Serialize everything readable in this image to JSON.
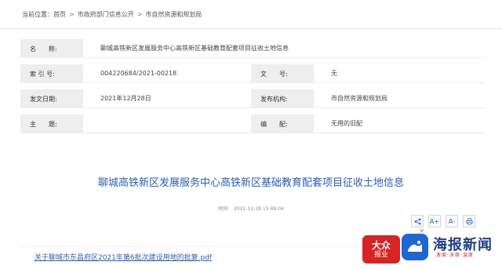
{
  "breadcrumb": {
    "label": "当前位置：",
    "items": [
      "首页",
      "市政府部门信息公开",
      "市自然资源和规划局"
    ],
    "separator": ">"
  },
  "info": {
    "name": {
      "label": "名　　称:",
      "value": "聊城高铁新区发展服务中心高铁新区基础教育配套项目征收土地信息"
    },
    "index": {
      "label": "索 引 号:",
      "value": "004220684/2021-00218"
    },
    "doc_no": {
      "label": "文　　号:",
      "value": "无"
    },
    "date": {
      "label": "发文日期:",
      "value": "2021年12月28日"
    },
    "org": {
      "label": "发布机构:",
      "value": "市自然资源和规划局"
    },
    "subject": {
      "label": "主　　题:",
      "value": ""
    },
    "category": {
      "label": "编　　配:",
      "value": "无用的旧配"
    }
  },
  "article": {
    "title": "聊城高铁新区发展服务中心高铁新区基础教育配套项目征收土地信息",
    "time_label": "时间:",
    "time": "2021-12-28 15:49:04"
  },
  "tools": [
    "share",
    "A+",
    "A-",
    "print"
  ],
  "attachment": "关于聊城市东昌府区2021年第6批次建设用地的批复.pdf",
  "logo": {
    "box_big": "大众",
    "box_small": "报业",
    "name": "海报新闻",
    "tag": "速度·深度·温度",
    "close": "×"
  }
}
